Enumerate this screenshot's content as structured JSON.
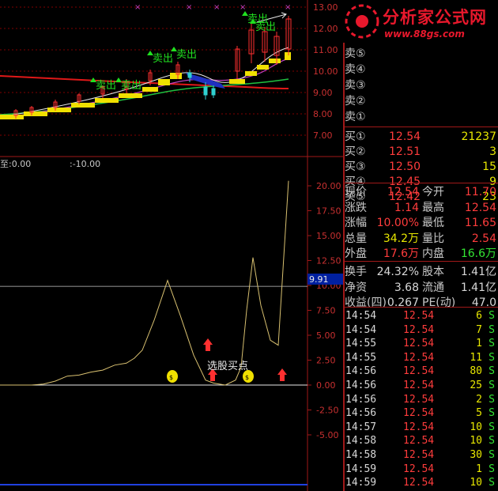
{
  "logo": {
    "name": "分析家公式网",
    "url": "www.88gs.com"
  },
  "price_chart": {
    "yticks": [
      "13.00",
      "12.00",
      "11.00",
      "10.00",
      "9.00",
      "8.00",
      "7.00"
    ],
    "sell_label": "卖出"
  },
  "indicator": {
    "header_left": "至:0.00",
    "header_right": ":-10.00",
    "yticks": [
      "20.00",
      "17.50",
      "15.00",
      "12.50",
      "10.00",
      "7.50",
      "5.00",
      "2.50",
      "0.00",
      "-2.50",
      "-5.00"
    ],
    "ref_value": "9.91",
    "buy_label": "选股买点"
  },
  "chart_data": {
    "type": "line",
    "title": "",
    "series": [
      {
        "values": [
          0,
          0,
          0.1,
          0.4,
          0.9,
          1.0,
          1.3,
          1.5,
          2.0,
          2.2,
          2.7,
          3.5,
          6.5,
          10.5,
          7.0,
          3.0,
          0.5,
          0.2,
          0.0,
          0.5,
          1.8,
          7.5,
          12.8,
          8.0,
          4.5,
          4.0,
          20.5
        ]
      }
    ],
    "ylim": [
      -5,
      21
    ],
    "ref_line": 9.91,
    "colors": {
      "line": "#d8c070",
      "zero": "#e8e8e8",
      "ref": "#c8c8c8"
    }
  },
  "order_book": {
    "asks": [
      {
        "label": "卖⑤",
        "price": "",
        "vol": ""
      },
      {
        "label": "卖④",
        "price": "",
        "vol": ""
      },
      {
        "label": "卖③",
        "price": "",
        "vol": ""
      },
      {
        "label": "卖②",
        "price": "",
        "vol": ""
      },
      {
        "label": "卖①",
        "price": "",
        "vol": ""
      }
    ],
    "bids": [
      {
        "label": "买①",
        "price": "12.54",
        "vol": "21237"
      },
      {
        "label": "买②",
        "price": "12.51",
        "vol": "3"
      },
      {
        "label": "买③",
        "price": "12.50",
        "vol": "15"
      },
      {
        "label": "买④",
        "price": "12.45",
        "vol": "9"
      },
      {
        "label": "买⑤",
        "price": "12.42",
        "vol": "23"
      }
    ]
  },
  "stats": [
    {
      "l1": "现价",
      "v1": "12.54",
      "l2": "今开",
      "v2": "11.70",
      "c1": "red",
      "c2": "red"
    },
    {
      "l1": "涨跌",
      "v1": "1.14",
      "l2": "最高",
      "v2": "12.54",
      "c1": "red",
      "c2": "red"
    },
    {
      "l1": "涨幅",
      "v1": "10.00%",
      "l2": "最低",
      "v2": "11.65",
      "c1": "red",
      "c2": "red"
    },
    {
      "l1": "总量",
      "v1": "34.2万",
      "l2": "量比",
      "v2": "2.54",
      "c1": "yellow",
      "c2": "red"
    },
    {
      "l1": "外盘",
      "v1": "17.6万",
      "l2": "内盘",
      "v2": "16.6万",
      "c1": "red",
      "c2": "green"
    },
    {
      "l1": "换手",
      "v1": "24.32%",
      "l2": "股本",
      "v2": "1.41亿",
      "c1": "white",
      "c2": "white"
    },
    {
      "l1": "净资",
      "v1": "3.68",
      "l2": "流通",
      "v2": "1.41亿",
      "c1": "white",
      "c2": "white"
    },
    {
      "l1": "收益(四)",
      "v1": "0.267",
      "l2": "PE(动)",
      "v2": "47.0",
      "c1": "white",
      "c2": "white"
    }
  ],
  "ticks": [
    {
      "time": "14:54",
      "price": "12.54",
      "vol": "6",
      "side": "S"
    },
    {
      "time": "14:54",
      "price": "12.54",
      "vol": "7",
      "side": "S"
    },
    {
      "time": "14:55",
      "price": "12.54",
      "vol": "1",
      "side": "S"
    },
    {
      "time": "14:55",
      "price": "12.54",
      "vol": "11",
      "side": "S"
    },
    {
      "time": "14:56",
      "price": "12.54",
      "vol": "80",
      "side": "S"
    },
    {
      "time": "14:56",
      "price": "12.54",
      "vol": "25",
      "side": "S"
    },
    {
      "time": "14:56",
      "price": "12.54",
      "vol": "2",
      "side": "S"
    },
    {
      "time": "14:56",
      "price": "12.54",
      "vol": "5",
      "side": "S"
    },
    {
      "time": "14:57",
      "price": "12.54",
      "vol": "10",
      "side": "S"
    },
    {
      "time": "14:58",
      "price": "12.54",
      "vol": "10",
      "side": "S"
    },
    {
      "time": "14:58",
      "price": "12.54",
      "vol": "30",
      "side": "S"
    },
    {
      "time": "14:59",
      "price": "12.54",
      "vol": "1",
      "side": "S"
    },
    {
      "time": "14:59",
      "price": "12.54",
      "vol": "10",
      "side": "S"
    }
  ]
}
